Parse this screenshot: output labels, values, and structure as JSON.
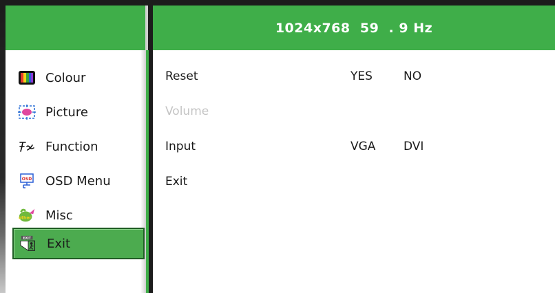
{
  "header": {
    "resolution": "1024x768  59  . 9 Hz"
  },
  "menu": {
    "items": [
      {
        "label": "Colour",
        "icon": "colour-bars-icon"
      },
      {
        "label": "Picture",
        "icon": "picture-position-icon"
      },
      {
        "label": "Function",
        "icon": "fx-function-icon"
      },
      {
        "label": "OSD Menu",
        "icon": "osd-menu-icon"
      },
      {
        "label": "Misc",
        "icon": "misc-other-icon"
      },
      {
        "label": "Exit",
        "icon": "exit-icon",
        "selected": true
      }
    ]
  },
  "icons": {
    "osd_text": "OSD",
    "misc_text": "other",
    "exit_text": "EXIT"
  },
  "function_rows": {
    "reset": {
      "label": "Reset",
      "options": [
        "YES",
        "NO"
      ]
    },
    "volume": {
      "label": "Volume",
      "disabled": true
    },
    "input": {
      "label": "Input",
      "options": [
        "VGA",
        "DVI"
      ]
    },
    "exit": {
      "label": "Exit"
    }
  },
  "colors": {
    "accent_green": "#3fae49",
    "selected_green": "#4cab4f",
    "disabled_text": "#c4c4c4"
  }
}
